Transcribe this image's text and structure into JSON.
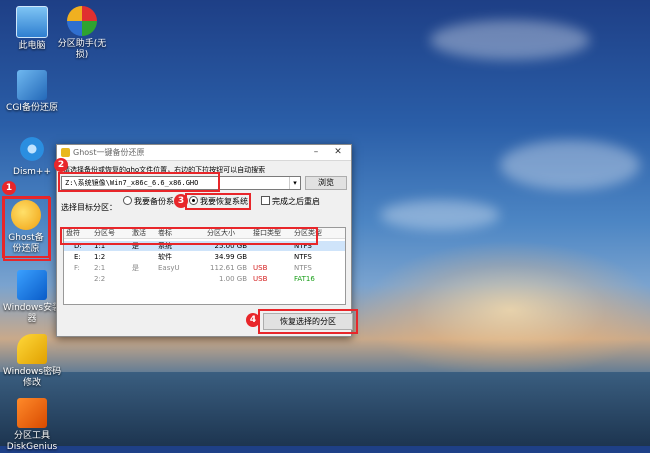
{
  "desktop": {
    "icons": [
      {
        "label": "此电脑"
      },
      {
        "label": "分区助手(无损)"
      },
      {
        "label": "CGI备份还原"
      },
      {
        "label": "Dism++"
      },
      {
        "label": "Ghost备份还原"
      },
      {
        "label": "Windows安装器"
      },
      {
        "label": "Windows密码修改"
      },
      {
        "label": "分区工具DiskGenius"
      }
    ]
  },
  "dialog": {
    "title": "Ghost一键备份还原",
    "hint": "请选择备份或恢复的gho文件位置，右边的下拉按钮可以自动搜索",
    "path_value": "Z:\\系统镜像\\Win7_x86c_6.6_x86.GHO",
    "browse_label": "浏览",
    "target_label": "选择目标分区：",
    "option_backup": "我要备份系统",
    "option_restore": "我要恢复系统",
    "option_reboot": "完成之后重启",
    "restore_button": "恢复选择的分区",
    "columns": [
      "盘符",
      "分区号",
      "激活",
      "卷标",
      "分区大小",
      "接口类型",
      "分区类型"
    ],
    "rows": [
      {
        "drive": "D:",
        "part": "1:1",
        "active": "是",
        "label": "系统",
        "size": "25.00 GB",
        "iface": "",
        "type": "NTFS"
      },
      {
        "drive": "E:",
        "part": "1:2",
        "active": "",
        "label": "软件",
        "size": "34.99 GB",
        "iface": "",
        "type": "NTFS"
      },
      {
        "drive": "F:",
        "part": "2:1",
        "active": "是",
        "label": "EasyU",
        "size": "112.61 GB",
        "iface": "USB",
        "type": "NTFS"
      },
      {
        "drive": "",
        "part": "2:2",
        "active": "",
        "label": "",
        "size": "1.00 GB",
        "iface": "USB",
        "type": "FAT16"
      }
    ]
  },
  "badges": [
    "1",
    "2",
    "3",
    "4"
  ],
  "colors": {
    "annotation": "#e8262a",
    "usb": "#d42020",
    "fat16": "#1aa01a"
  }
}
